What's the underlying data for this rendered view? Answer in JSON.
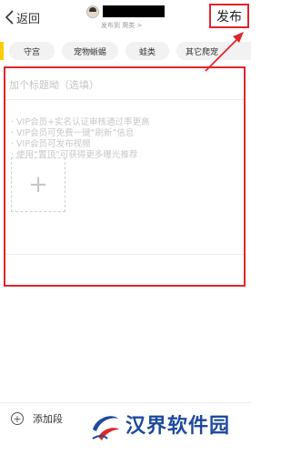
{
  "header": {
    "back_label": "返回",
    "sub_line": "发布到 爬类 >",
    "publish_label": "发布"
  },
  "categories": [
    "守宫",
    "宠物蜥蜴",
    "蛙类",
    "其它爬宠"
  ],
  "editor": {
    "title_placeholder": "加个标题呦（选填）",
    "tips": [
      "· VIP会员+实名认证审核通过率更高",
      "· VIP会员可免费一键“刷新”信息",
      "· VIP会员可发布视频",
      "· 使用“置顶”可获得更多曝光推荐"
    ],
    "add_image_symbol": "+"
  },
  "bottom": {
    "add_section_symbol": "+",
    "add_section_label": "添加段"
  },
  "watermark": {
    "text": "汉界软件园"
  },
  "colors": {
    "highlight": "#e0252a",
    "accent_yellow": "#ffcc00"
  }
}
